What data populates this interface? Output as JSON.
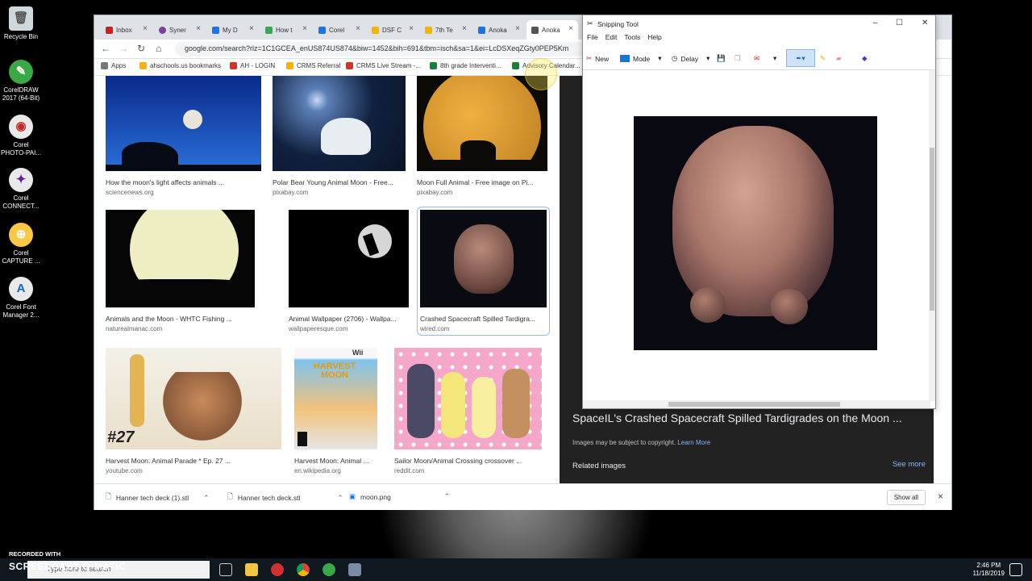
{
  "desktop": {
    "icons": [
      {
        "label": "Recycle Bin"
      },
      {
        "label": "CorelDRAW 2017 (64-Bit)"
      },
      {
        "label": "Corel PHOTO-PAI..."
      },
      {
        "label": "Corel CONNECT..."
      },
      {
        "label": "Corel CAPTURE ..."
      },
      {
        "label": "Corel Font Manager 2..."
      }
    ]
  },
  "browser": {
    "tabs": [
      {
        "label": "Inbox",
        "color": "#c5221f"
      },
      {
        "label": "Syner",
        "color": "#7b3fa0"
      },
      {
        "label": "My D",
        "color": "#1a73e8"
      },
      {
        "label": "How t",
        "color": "#34a853"
      },
      {
        "label": "Corel",
        "color": "#1a73e8"
      },
      {
        "label": "DSF C",
        "color": "#f4b400"
      },
      {
        "label": "7th Te",
        "color": "#f4b400"
      },
      {
        "label": "Anoka",
        "color": "#1a73e8"
      },
      {
        "label": "Anoka",
        "color": "#555555"
      }
    ],
    "url": "google.com/search?rlz=1C1GCEA_enUS874US874&biw=1452&bih=691&tbm=isch&sa=1&ei=LcDSXeqZGty0PEP5Km",
    "bookmarks": [
      {
        "label": "Apps",
        "color": "#777777"
      },
      {
        "label": "ahschools.us bookmarks",
        "color": "#f4b400"
      },
      {
        "label": "AH - LOGIN",
        "color": "#d93025"
      },
      {
        "label": "CRMS Referral",
        "color": "#f4b400"
      },
      {
        "label": "CRMS Live Stream -...",
        "color": "#d93025"
      },
      {
        "label": "8th grade Interventi...",
        "color": "#188038"
      },
      {
        "label": "Advisory Calendar...",
        "color": "#188038"
      }
    ],
    "results": [
      {
        "caption": "How the moon's light affects animals ...",
        "source": "sciencenews.org"
      },
      {
        "caption": "Polar Bear Young Animal Moon - Free...",
        "source": "pixabay.com"
      },
      {
        "caption": "Moon Full Animal - Free image on Pi...",
        "source": "pixabay.com"
      },
      {
        "caption": "Animals and the Moon - WHTC Fishing ...",
        "source": "naturealmanac.com"
      },
      {
        "caption": "Animal Wallpaper (2706) - Wallpa...",
        "source": "wallpaperesque.com"
      },
      {
        "caption": "Crashed Spacecraft Spilled Tardigra...",
        "source": "wired.com"
      },
      {
        "caption": "Harvest Moon: Animal Parade * Ep. 27 ...",
        "source": "youtube.com"
      },
      {
        "caption": "Harvest Moon: Animal ...",
        "source": "en.wikipedia.org"
      },
      {
        "caption": "Sailor Moon/Animal Crossing crossover ...",
        "source": "reddit.com"
      }
    ],
    "thumb_text": {
      "ep_number": "#27",
      "game_title": "HARVEST MOON",
      "platform": "Wii"
    },
    "preview": {
      "title": "SpaceIL's Crashed Spacecraft Spilled Tardigrades on the Moon ...",
      "copyright": "Images may be subject to copyright.",
      "learn_more": "Learn More",
      "related": "Related images",
      "see_more": "See more"
    },
    "downloads": [
      {
        "name": "Hanner tech deck (1).stl"
      },
      {
        "name": "Hanner tech deck.stl"
      },
      {
        "name": "moon.png"
      }
    ],
    "show_all": "Show all"
  },
  "snipping_tool": {
    "title": "Snipping Tool",
    "menu": [
      "File",
      "Edit",
      "Tools",
      "Help"
    ],
    "toolbar": {
      "new": "New",
      "mode": "Mode",
      "delay": "Delay"
    }
  },
  "taskbar": {
    "search_placeholder": "Type here to search",
    "time": "2:46 PM",
    "date": "11/18/2019"
  },
  "watermark": {
    "line1": "RECORDED WITH",
    "line2": "SCREENCAST-O-MATIC"
  }
}
